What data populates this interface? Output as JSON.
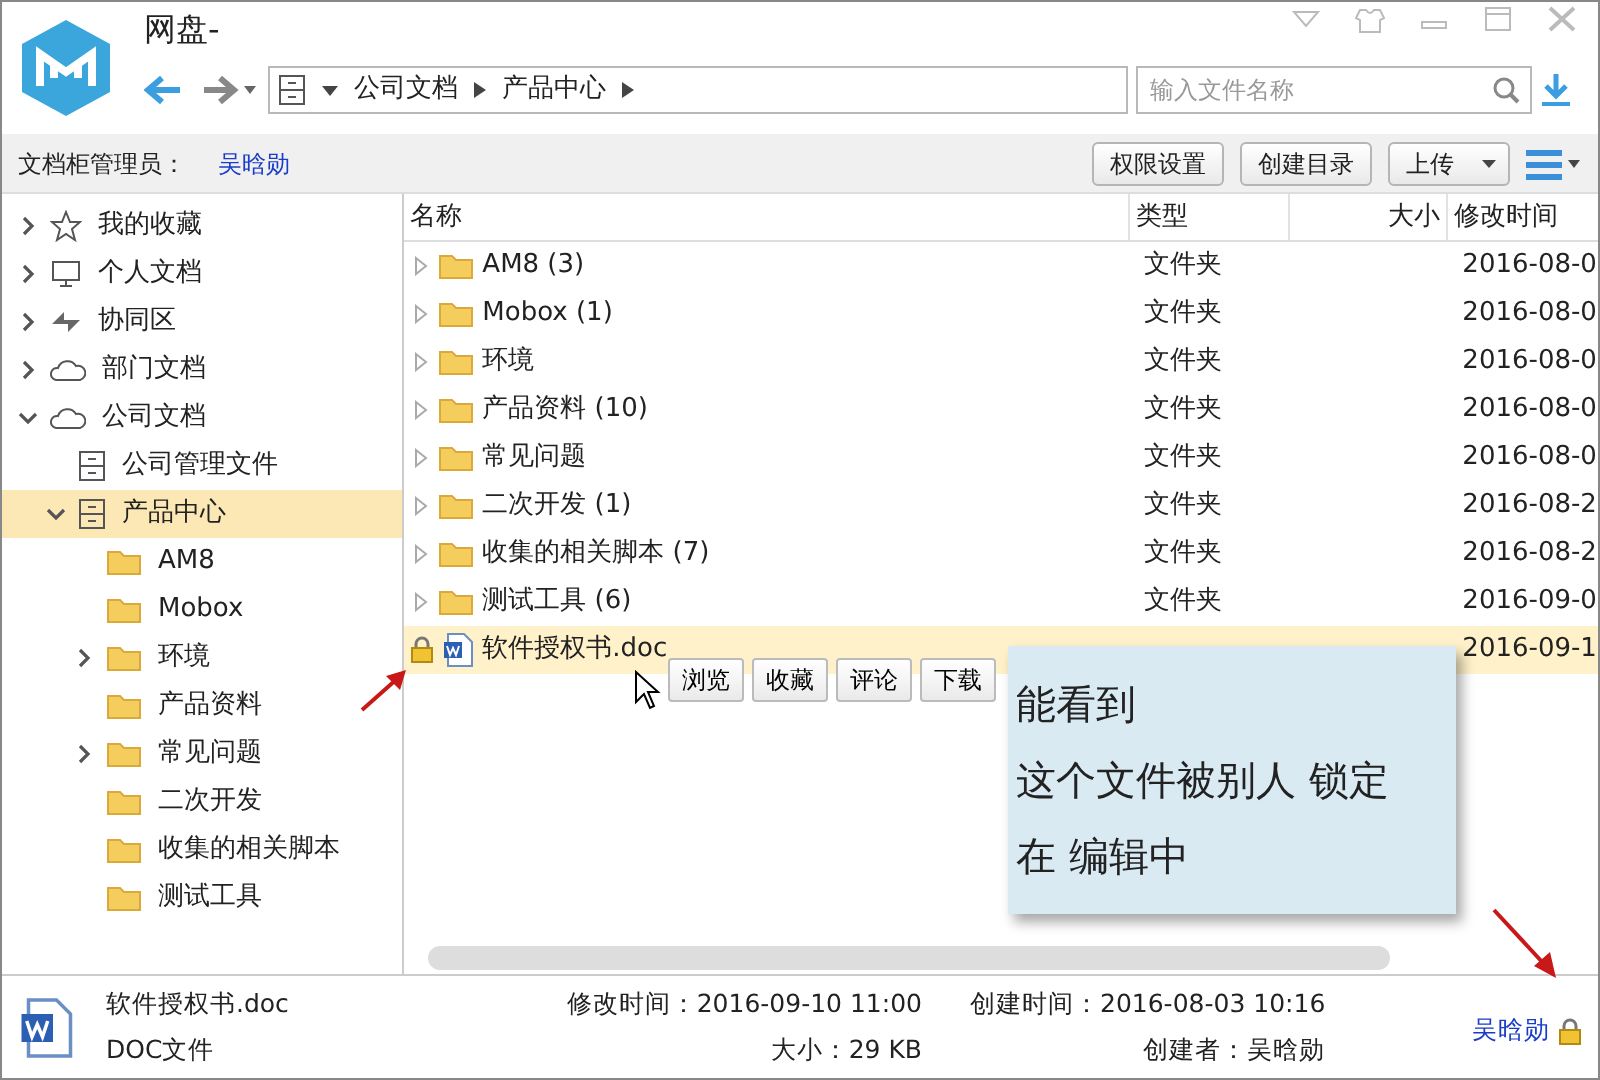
{
  "window": {
    "title": "网盘-"
  },
  "address": {
    "path": [
      {
        "label": "公司文档"
      },
      {
        "label": "产品中心"
      }
    ],
    "search_placeholder": "输入文件名称"
  },
  "toolbar": {
    "admin_label": "文档柜管理员：",
    "admin_name": "吴晗勋",
    "buttons": [
      {
        "label": "权限设置",
        "kind": "plain"
      },
      {
        "label": "创建目录",
        "kind": "plain"
      },
      {
        "label": "上传",
        "kind": "dropdown"
      }
    ]
  },
  "sidebar": {
    "items": [
      {
        "label": "我的收藏",
        "kind": "favorites",
        "has_children": true,
        "expanded": false,
        "selected": false
      },
      {
        "label": "个人文档",
        "kind": "personal",
        "has_children": true,
        "expanded": false,
        "selected": false
      },
      {
        "label": "协同区",
        "kind": "shared",
        "has_children": true,
        "expanded": false,
        "selected": false
      },
      {
        "label": "部门文档",
        "kind": "cloud",
        "has_children": true,
        "expanded": false,
        "selected": false
      },
      {
        "label": "公司文档",
        "kind": "cloud",
        "has_children": true,
        "expanded": true,
        "selected": false,
        "children": [
          {
            "label": "公司管理文件",
            "kind": "cabinet",
            "has_children": false,
            "expanded": false,
            "selected": false
          },
          {
            "label": "产品中心",
            "kind": "cabinet",
            "has_children": true,
            "expanded": true,
            "selected": true,
            "children": [
              {
                "label": "AM8",
                "kind": "folder",
                "has_children": false,
                "expanded": false,
                "selected": false
              },
              {
                "label": "Mobox",
                "kind": "folder",
                "has_children": false,
                "expanded": false,
                "selected": false
              },
              {
                "label": "环境",
                "kind": "folder",
                "has_children": true,
                "expanded": false,
                "selected": false
              },
              {
                "label": "产品资料",
                "kind": "folder",
                "has_children": false,
                "expanded": false,
                "selected": false
              },
              {
                "label": "常见问题",
                "kind": "folder",
                "has_children": true,
                "expanded": false,
                "selected": false
              },
              {
                "label": "二次开发",
                "kind": "folder",
                "has_children": false,
                "expanded": false,
                "selected": false
              },
              {
                "label": "收集的相关脚本",
                "kind": "folder",
                "has_children": false,
                "expanded": false,
                "selected": false
              },
              {
                "label": "测试工具",
                "kind": "folder",
                "has_children": false,
                "expanded": false,
                "selected": false
              }
            ]
          }
        ]
      }
    ]
  },
  "table": {
    "columns": [
      "名称",
      "类型",
      "大小",
      "修改时间"
    ],
    "rows": [
      {
        "kind": "folder",
        "name": "AM8 (3)",
        "type": "文件夹",
        "modified": "2016-08-0",
        "selected": false,
        "locked": false
      },
      {
        "kind": "folder",
        "name": "Mobox (1)",
        "type": "文件夹",
        "modified": "2016-08-0",
        "selected": false,
        "locked": false
      },
      {
        "kind": "folder",
        "name": "环境",
        "type": "文件夹",
        "modified": "2016-08-0",
        "selected": false,
        "locked": false
      },
      {
        "kind": "folder",
        "name": "产品资料 (10)",
        "type": "文件夹",
        "modified": "2016-08-0",
        "selected": false,
        "locked": false
      },
      {
        "kind": "folder",
        "name": "常见问题",
        "type": "文件夹",
        "modified": "2016-08-0",
        "selected": false,
        "locked": false
      },
      {
        "kind": "folder",
        "name": "二次开发 (1)",
        "type": "文件夹",
        "modified": "2016-08-2",
        "selected": false,
        "locked": false
      },
      {
        "kind": "folder",
        "name": "收集的相关脚本 (7)",
        "type": "文件夹",
        "modified": "2016-08-2",
        "selected": false,
        "locked": false
      },
      {
        "kind": "folder",
        "name": "测试工具 (6)",
        "type": "文件夹",
        "modified": "2016-09-0",
        "selected": false,
        "locked": false
      },
      {
        "kind": "file",
        "name": "软件授权书.doc",
        "modified": "2016-09-1",
        "selected": true,
        "locked": true
      }
    ],
    "row_actions": [
      "浏览",
      "收藏",
      "评论",
      "下载"
    ]
  },
  "callout": {
    "lines": [
      "能看到",
      "这个文件被别人 锁定",
      "在 编辑中"
    ]
  },
  "status_bar": {
    "file_name": "软件授权书.doc",
    "file_type": "DOC文件",
    "modified": "修改时间：2016-09-10 11:00",
    "created": "创建时间：2016-08-03 10:16",
    "size": "大小：29 KB",
    "creator": "创建者：吴晗勋",
    "lock_owner": "吴晗勋",
    "locked": true
  }
}
